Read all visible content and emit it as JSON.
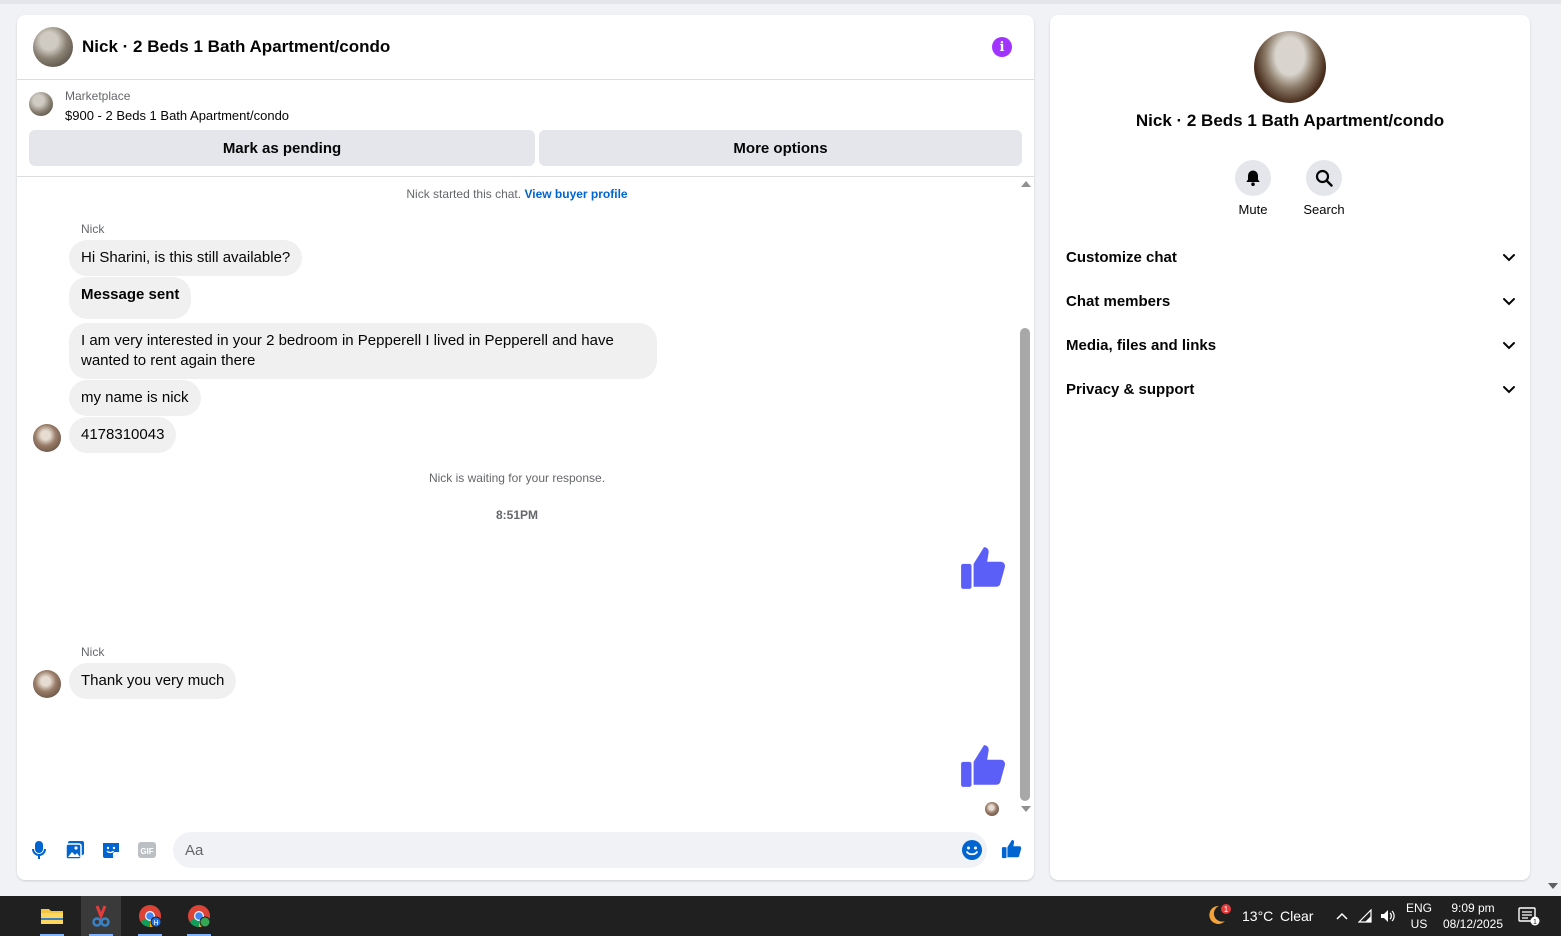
{
  "header": {
    "title": "Nick · 2 Beds 1 Bath Apartment/condo",
    "info_icon": "info-icon"
  },
  "listing": {
    "label": "Marketplace",
    "title": "$900 - 2 Beds 1 Bath Apartment/condo"
  },
  "actions": {
    "pending_label": "Mark as pending",
    "more_label": "More options"
  },
  "conversation": {
    "started_text": "Nick started this chat.",
    "buyer_profile_link": "View buyer profile",
    "sender_name_1": "Nick",
    "messages": [
      "Hi Sharini, is this still available?",
      "Message sent",
      "I am very interested in your 2 bedroom in Pepperell I lived in Pepperell and have wanted to rent again there",
      "my name is nick",
      "4178310043"
    ],
    "waiting_text": "Nick is waiting for your response.",
    "timestamp": "8:51PM",
    "sender_name_2": "Nick",
    "reply_message": "Thank you very much"
  },
  "composer": {
    "placeholder": "Aa",
    "icons": [
      "microphone-icon",
      "photo-icon",
      "sticker-icon",
      "gif-icon",
      "emoji-icon",
      "like-icon"
    ],
    "gif_label": "GIF"
  },
  "right_panel": {
    "name": "Nick · 2 Beds 1 Bath Apartment/condo",
    "mute_label": "Mute",
    "search_label": "Search",
    "sections": [
      "Customize chat",
      "Chat members",
      "Media, files and links",
      "Privacy & support"
    ]
  },
  "taskbar": {
    "weather_temp": "13°C",
    "weather_desc": "Clear",
    "weather_badge": "1",
    "lang_top": "ENG",
    "lang_bottom": "US",
    "time": "9:09 pm",
    "date": "08/12/2025",
    "notification_count": "1"
  },
  "colors": {
    "accent_blue": "#0064d1",
    "like_purple": "#5b5ef7",
    "info_purple": "#a033ff"
  }
}
